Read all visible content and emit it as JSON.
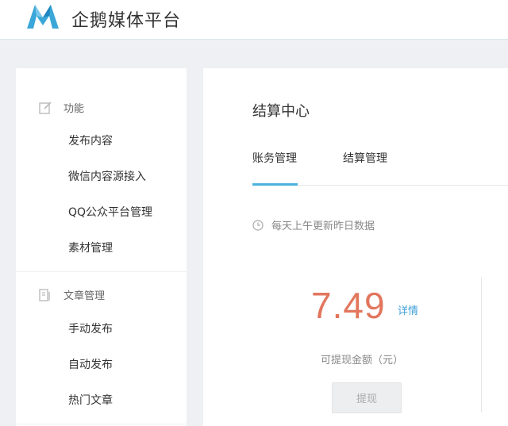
{
  "header": {
    "brand": "企鹅媒体平台",
    "logo_icon": "penguin-media-logo-icon",
    "accent": "#3aa7d8"
  },
  "sidebar": {
    "groups": [
      {
        "title": "功能",
        "icon": "edit-icon",
        "items": [
          "发布内容",
          "微信内容源接入",
          "QQ公众平台管理",
          "素材管理"
        ]
      },
      {
        "title": "文章管理",
        "icon": "article-icon",
        "items": [
          "手动发布",
          "自动发布",
          "热门文章"
        ]
      }
    ]
  },
  "main": {
    "title": "结算中心",
    "tabs": [
      {
        "label": "账务管理",
        "active": true
      },
      {
        "label": "结算管理",
        "active": false
      }
    ],
    "notice": "每天上午更新昨日数据",
    "notice_icon": "clock-icon",
    "amount": "7.49",
    "amount_color": "#e2765d",
    "detail_link": "详情",
    "amount_label": "可提现金额（元）",
    "withdraw_button": "提现"
  }
}
